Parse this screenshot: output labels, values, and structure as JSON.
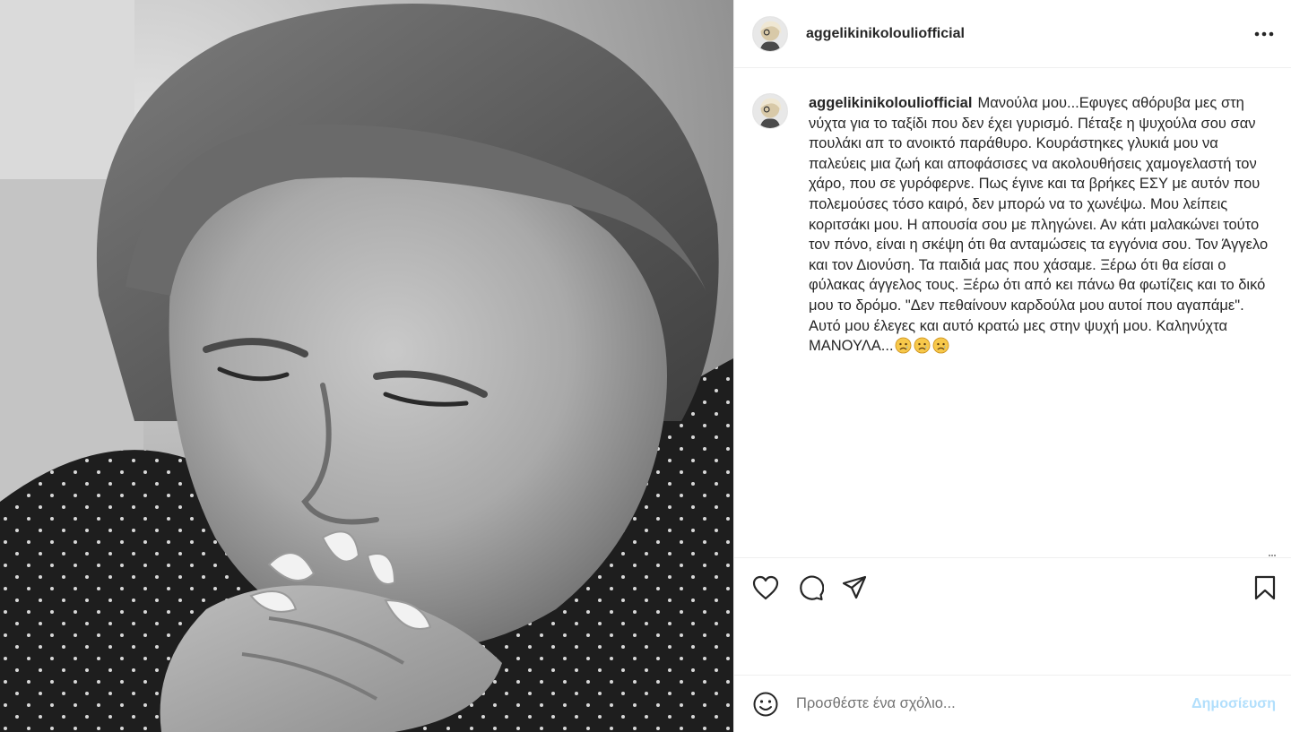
{
  "post": {
    "username": "aggelikinikolouliofficial",
    "caption": "Μανούλα μου...Εφυγες αθόρυβα μες στη νύχτα για το ταξίδι που δεν έχει γυρισμό. Πέταξε η ψυχούλα σου σαν πουλάκι απ το ανοικτό παράθυρο. Κουράστηκες γλυκιά μου να παλεύεις μια ζωή και αποφάσισες να ακολουθήσεις χαμογελαστή τον χάρο, που σε γυρόφερνε. Πως έγινε και τα βρήκες ΕΣΥ με αυτόν που πολεμούσες τόσο καιρό, δεν μπορώ να το χωνέψω. Μου λείπεις κοριτσάκι μου. Η απουσία σου με πληγώνει. Αν κάτι μαλακώνει τούτο τον πόνο, είναι η σκέψη ότι θα ανταμώσεις τα εγγόνια σου. Τον Άγγελο και τον Διονύση. Τα παιδιά μας που χάσαμε. Ξέρω ότι θα είσαι ο φύλακας άγγελος τους. Ξέρω ότι από κει πάνω θα φωτίζεις και το δικό μου το δρόμο. \"Δεν πεθαίνουν καρδούλα μου αυτοί που αγαπάμε\". Αυτό μου έλεγες και αυτό κρατώ μες στην ψυχή μου. Καληνύχτα ΜΑΝΟΥΛΑ...",
    "caption_emojis": [
      "sad-face-emoji",
      "sad-face-emoji",
      "sad-face-emoji"
    ]
  },
  "icons": {
    "more": "more-options-icon",
    "like": "heart-icon",
    "comment": "comment-icon",
    "share": "share-icon",
    "save": "bookmark-icon",
    "emoji": "emoji-icon"
  },
  "comment_box": {
    "placeholder": "Προσθέστε ένα σχόλιο...",
    "post_label": "Δημοσίευση"
  },
  "colors": {
    "post_button_disabled": "#b2dffc",
    "divider": "#efefef",
    "text": "#262626",
    "placeholder": "#737373"
  }
}
